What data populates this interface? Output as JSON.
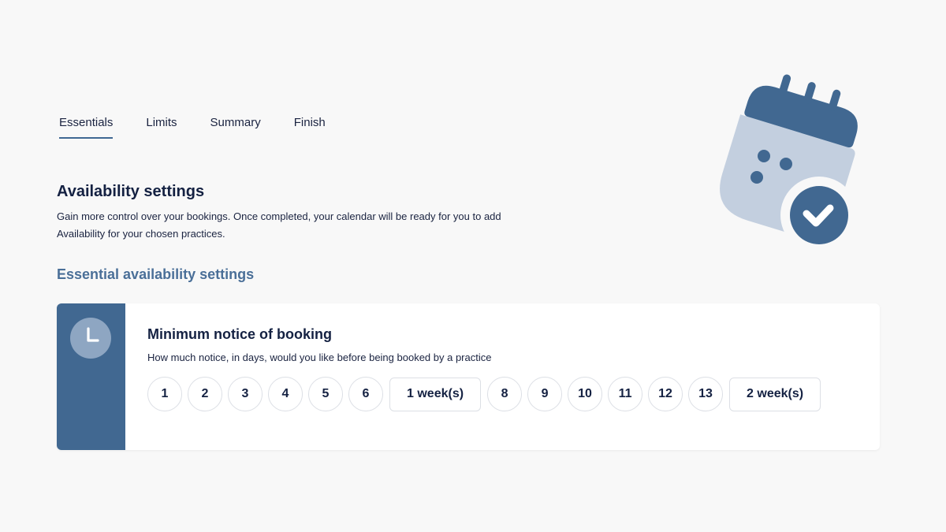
{
  "tabs": [
    {
      "label": "Essentials",
      "active": true
    },
    {
      "label": "Limits",
      "active": false
    },
    {
      "label": "Summary",
      "active": false
    },
    {
      "label": "Finish",
      "active": false
    }
  ],
  "intro": {
    "title": "Availability settings",
    "description": "Gain more control over your bookings. Once completed, your calendar will be ready for you to add Availability for your chosen practices."
  },
  "section": {
    "title": "Essential availability settings"
  },
  "card": {
    "icon": "clock-icon",
    "title": "Minimum notice of booking",
    "description": "How much notice, in days, would you like before being booked by a practice",
    "options": [
      "1",
      "2",
      "3",
      "4",
      "5",
      "6",
      "1 week(s)",
      "8",
      "9",
      "10",
      "11",
      "12",
      "13",
      "2 week(s)"
    ]
  },
  "illustration": {
    "icon": "calendar-check-icon"
  },
  "colors": {
    "accent": "#416891",
    "section_title": "#4a6f98",
    "text": "#142142",
    "background": "#f8f8f8",
    "illustration_light": "#c3cfdf"
  }
}
